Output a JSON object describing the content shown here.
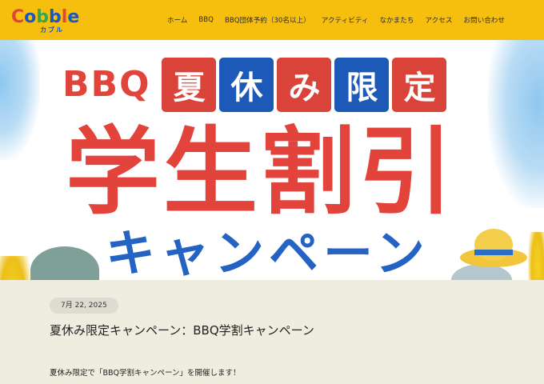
{
  "header": {
    "logo_text": "Cobble",
    "logo_subtext": "カブル",
    "nav": [
      {
        "label": "ホーム"
      },
      {
        "label": "BBQ"
      },
      {
        "label": "BBQ団体予約（30名以上）"
      },
      {
        "label": "アクティビティ"
      },
      {
        "label": "なかまたち"
      },
      {
        "label": "アクセス"
      },
      {
        "label": "お問い合わせ"
      }
    ]
  },
  "hero": {
    "bbq": "BBQ",
    "tags": [
      "夏",
      "休",
      "み",
      "限",
      "定"
    ],
    "title": "学生割引",
    "campaign": "キャンペーン"
  },
  "post": {
    "date": "7月 22, 2025",
    "title": "夏休み限定キャンペーン：BBQ学割キャンペーン",
    "body": "夏休み限定で「BBQ学割キャンペーン」を開催します！"
  },
  "colors": {
    "header_bg": "#f6be0f",
    "red": "#d9433a",
    "blue": "#1d59b6",
    "content_bg": "#efede0"
  }
}
